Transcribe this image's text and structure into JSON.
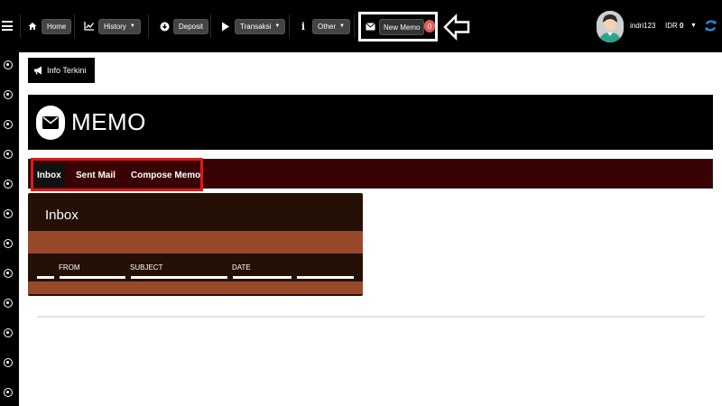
{
  "topbar": {
    "nav": [
      {
        "label": "Home",
        "icon": "home-icon",
        "has_caret": false
      },
      {
        "label": "History",
        "icon": "chart-icon",
        "has_caret": true
      },
      {
        "label": "Deposit",
        "icon": "deposit-icon",
        "has_caret": false
      },
      {
        "label": "Transaksi",
        "icon": "play-icon",
        "has_caret": true
      },
      {
        "label": "Other",
        "icon": "info-icon",
        "has_caret": true
      }
    ],
    "new_memo": {
      "label": "New Memo",
      "count": "0"
    },
    "user": {
      "username": "indri123",
      "currency": "IDR",
      "balance": "0"
    }
  },
  "info_button": {
    "label": "Info Terkini"
  },
  "memo": {
    "title": "MEMO"
  },
  "tabs": [
    {
      "label": "Inbox",
      "active": true
    },
    {
      "label": "Sent Mail",
      "active": false
    },
    {
      "label": "Compose Memo",
      "active": false
    }
  ],
  "inbox": {
    "title": "Inbox",
    "columns": [
      "FROM",
      "SUBJECT",
      "DATE"
    ]
  },
  "colors": {
    "topbar": "#000000",
    "tabs_bar": "#3a0303",
    "panel": "#241005",
    "band": "#98492a",
    "highlight_red": "#e01818",
    "badge": "#e25b5b"
  }
}
